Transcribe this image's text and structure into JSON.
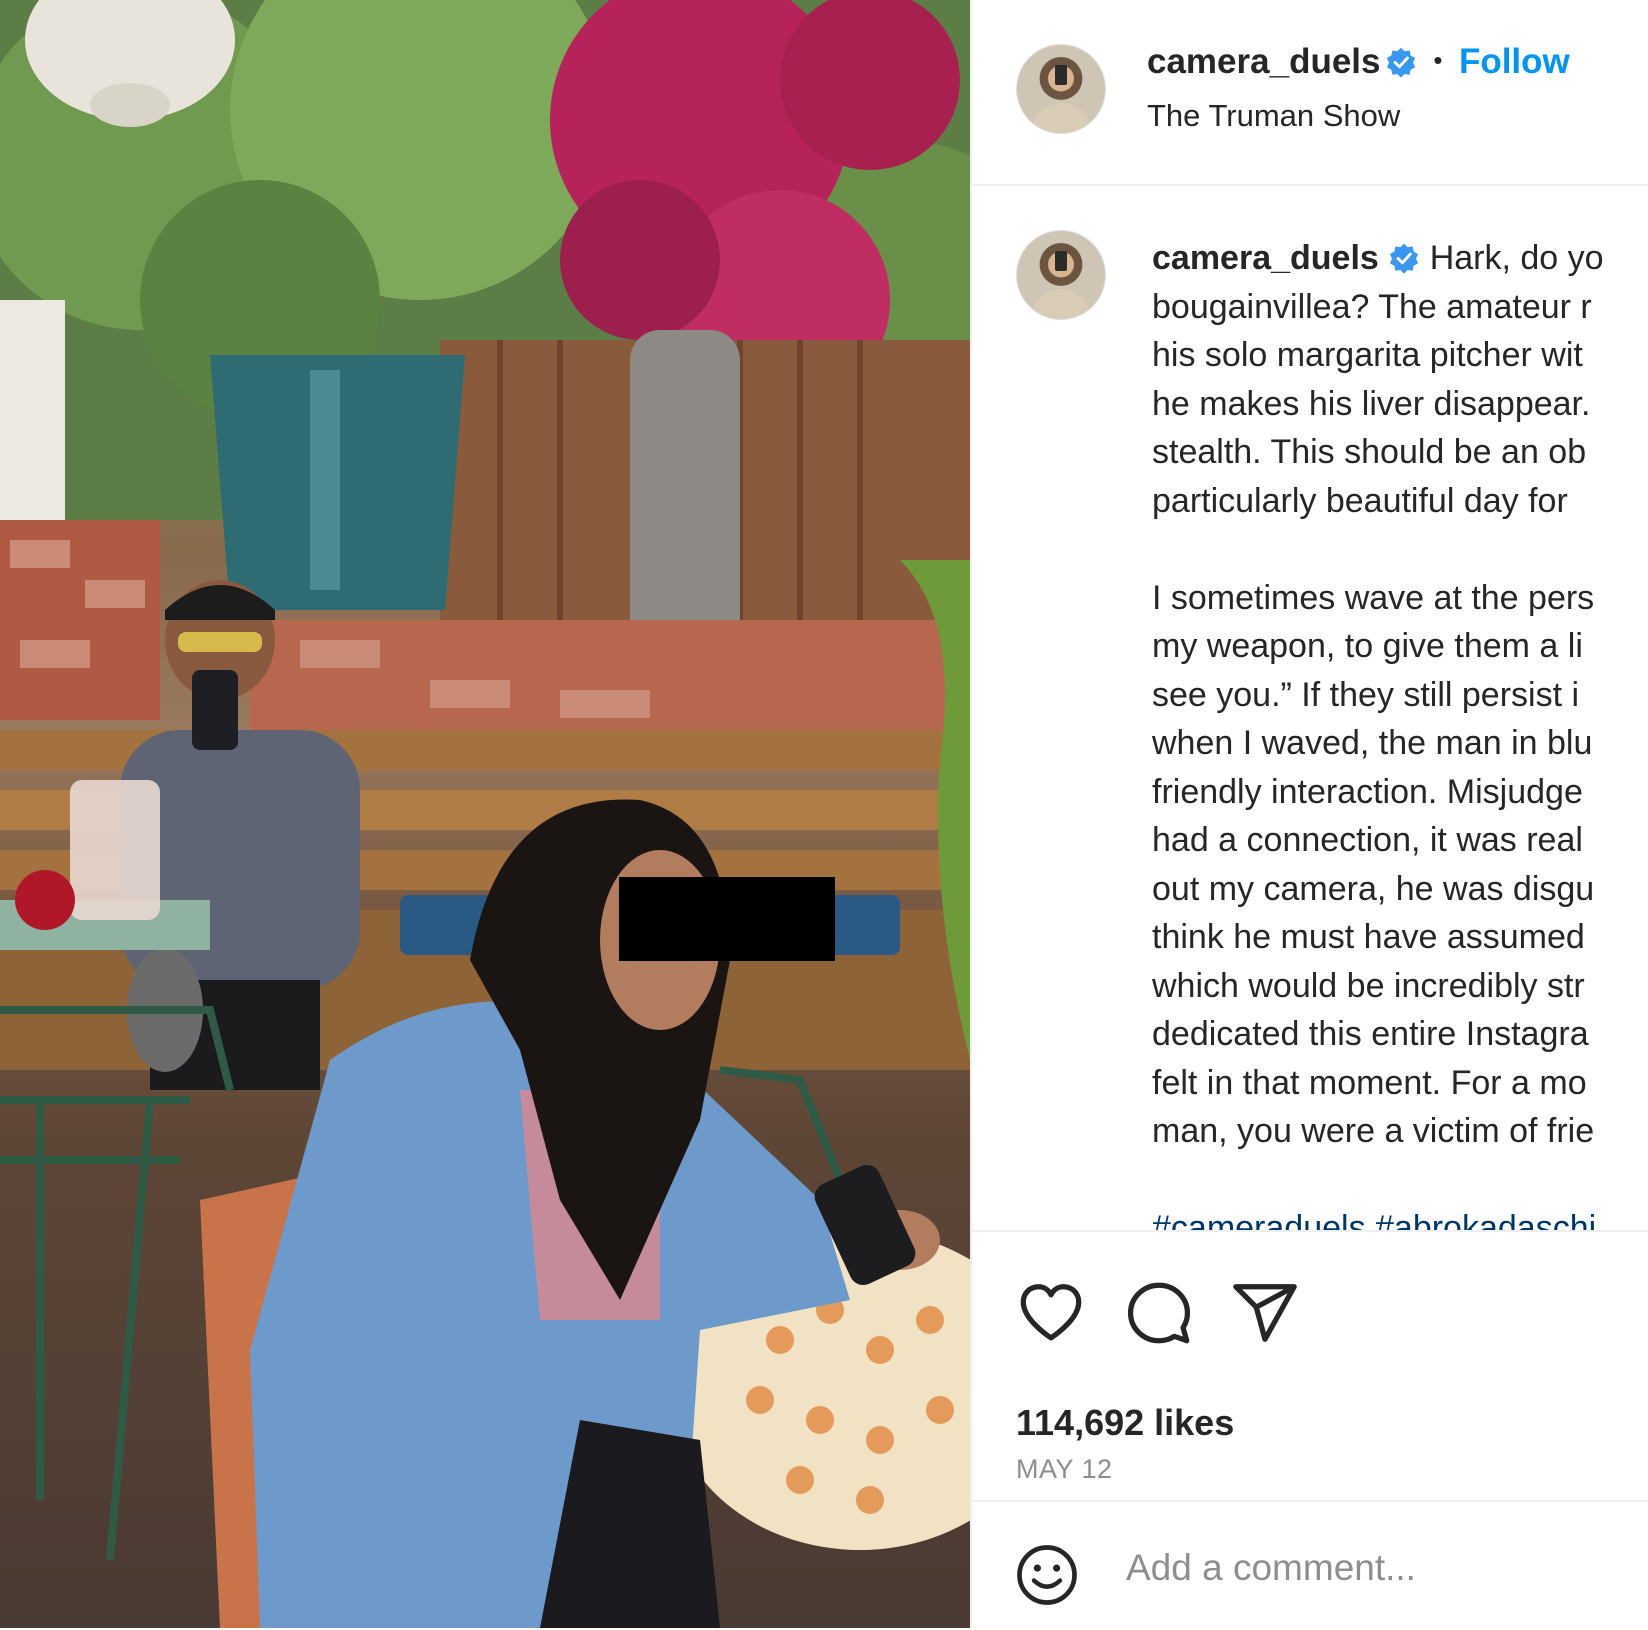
{
  "post": {
    "username": "camera_duels",
    "separator": "•",
    "follow_label": "Follow",
    "location": "The Truman Show"
  },
  "caption": {
    "username": "camera_duels",
    "lines": [
      "Hark, do yo",
      "bougainvillea? The amateur r",
      "his solo margarita pitcher wit",
      "he makes his liver disappear.",
      "stealth. This should be an ob",
      "particularly beautiful day for"
    ],
    "lines2": [
      "I sometimes wave at the pers",
      "my weapon, to give them a li",
      "see you.” If they still persist i",
      "when I waved, the man in blu",
      "friendly interaction. Misjudge",
      "had a connection, it was real",
      "out my camera, he was disgu",
      "think he must have assumed",
      "which would be incredibly str",
      "dedicated this entire Instagra",
      "felt in that moment. For a mo",
      "man, you were a victim of frie"
    ],
    "hashtags": "#cameraduels #abrokadaschi"
  },
  "actions": {
    "like_icon": "heart-icon",
    "comment_icon": "comment-icon",
    "share_icon": "paper-plane-icon"
  },
  "stats": {
    "likes": "114,692 likes",
    "date": "MAY 12"
  },
  "comment": {
    "emoji_icon": "smiley-icon",
    "placeholder": "Add a comment..."
  },
  "colors": {
    "accent": "#0095f6",
    "verified": "#3897f0",
    "muted": "#8e8e8e",
    "text": "#262626"
  }
}
